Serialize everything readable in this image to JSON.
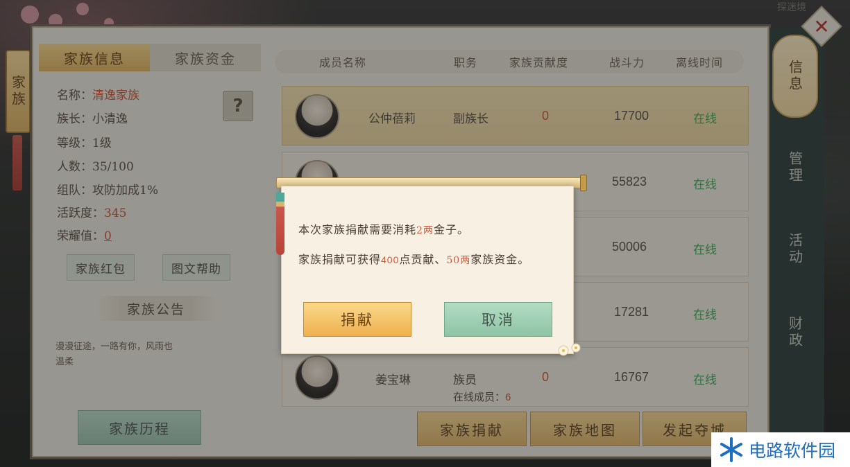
{
  "left_tab": "家族",
  "info_tabs": [
    "家族信息",
    "家族资金"
  ],
  "info": {
    "name_label": "名称：",
    "name_value": "清逸家族",
    "leader_label": "族长：",
    "leader_value": "小清逸",
    "level_label": "等级：",
    "level_value": "1级",
    "people_label": "人数：",
    "people_value": "35/100",
    "team_label": "组队：",
    "team_value": "攻防加成1%",
    "activity_label": "活跃度：",
    "activity_value": "345",
    "honor_label": "荣耀值：",
    "honor_value": "0"
  },
  "help_button": "?",
  "buttons": {
    "red_packet": "家族红包",
    "help_text": "图文帮助",
    "history": "家族历程"
  },
  "notice": {
    "title": "家族公告",
    "line1": "漫漫征途，一路有你，风雨也",
    "line2": "温柔"
  },
  "table": {
    "headers": [
      "成员名称",
      "职务",
      "家族贡献度",
      "战斗力",
      "离线时间"
    ],
    "rows": [
      {
        "name": "公仲蓓莉",
        "role": "副族长",
        "contrib": "0",
        "power": "17700",
        "status": "在线"
      },
      {
        "name": "",
        "role": "",
        "contrib": "",
        "power": "55823",
        "status": "在线"
      },
      {
        "name": "",
        "role": "",
        "contrib": "",
        "power": "50006",
        "status": "在线"
      },
      {
        "name": "",
        "role": "",
        "contrib": "",
        "power": "17281",
        "status": "在线"
      },
      {
        "name": "姜宝琳",
        "role": "族员",
        "contrib": "0",
        "power": "16767",
        "status": "在线"
      }
    ],
    "online_label": "在线成员：",
    "online_count": "6"
  },
  "bottom_buttons": [
    "家族捐献",
    "家族地图",
    "发起夺城"
  ],
  "right_tabs": [
    "信息",
    "管理",
    "活动",
    "财政"
  ],
  "close_label": "✕",
  "top_right_text": "探迷境",
  "dialog": {
    "line1_pre": "本次家族捐献需要消耗",
    "line1_amount": "2两",
    "line1_post": "金子。",
    "line2_pre": "家族捐献可获得",
    "line2_points": "400",
    "line2_mid": "点贡献、",
    "line2_funds": "50两",
    "line2_post": "家族资金。",
    "confirm": "捐献",
    "cancel": "取消"
  },
  "watermark": "电路软件园"
}
